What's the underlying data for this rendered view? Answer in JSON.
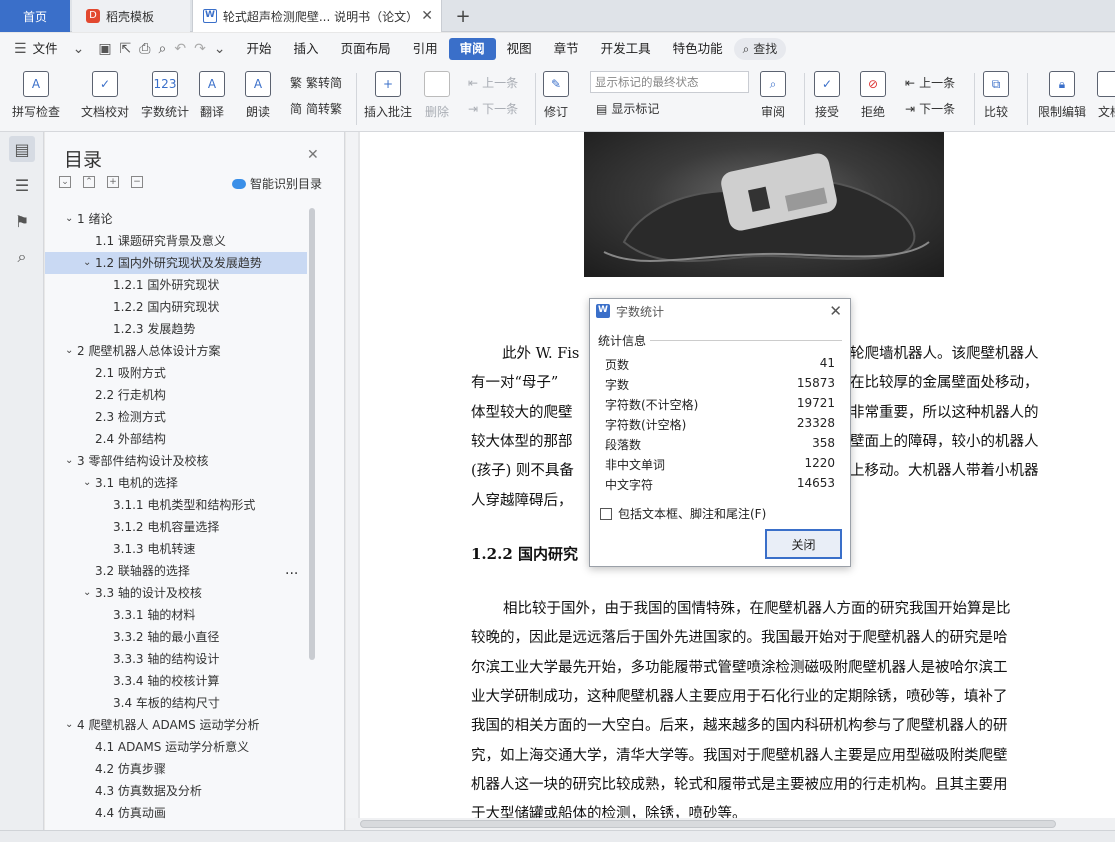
{
  "titlebar": {
    "home_tab": "首页",
    "template_tab": "稻壳模板",
    "doc_tab": "轮式超声检测爬壁... 说明书（论文）",
    "close_glyph": "✕",
    "add_glyph": "+"
  },
  "menubar": {
    "file": "文件",
    "items": [
      "开始",
      "插入",
      "页面布局",
      "引用",
      "审阅",
      "视图",
      "章节",
      "开发工具",
      "特色功能"
    ],
    "active": "审阅",
    "search": "查找"
  },
  "ribbon": {
    "spellcheck": "拼写检查",
    "proofread": "文档校对",
    "wordcount": "字数统计",
    "translate": "翻译",
    "read_aloud": "朗读",
    "trad_to_simp": "繁转简",
    "simp_to_trad": "简转繁",
    "insert_comment": "插入批注",
    "delete": "删除",
    "prev_item": "上一条",
    "next_item": "下一条",
    "track_changes": "修订",
    "markup_state": "显示标记的最终状态",
    "show_markup": "显示标记",
    "review": "审阅",
    "accept": "接受",
    "reject": "拒绝",
    "prev": "上一条",
    "next": "下一条",
    "compare": "比较",
    "restrict": "限制编辑",
    "doc_right": "文档"
  },
  "toc": {
    "title": "目录",
    "smart": "智能识别目录",
    "items": [
      {
        "text": "1  绪论",
        "level": 1,
        "exp": true
      },
      {
        "text": "1.1 课题研究背景及意义",
        "level": 2
      },
      {
        "text": "1.2 国内外研究现状及发展趋势",
        "level": 2,
        "exp": true,
        "sel": true
      },
      {
        "text": "1.2.1 国外研究现状",
        "level": 3
      },
      {
        "text": "1.2.2 国内研究现状",
        "level": 3
      },
      {
        "text": "1.2.3 发展趋势",
        "level": 3
      },
      {
        "text": "2 爬壁机器人总体设计方案",
        "level": 1,
        "exp": true
      },
      {
        "text": "2.1 吸附方式",
        "level": 2
      },
      {
        "text": "2.2 行走机构",
        "level": 2
      },
      {
        "text": "2.3 检测方式",
        "level": 2
      },
      {
        "text": "2.4 外部结构",
        "level": 2
      },
      {
        "text": "3 零部件结构设计及校核",
        "level": 1,
        "exp": true
      },
      {
        "text": "3.1 电机的选择",
        "level": 2,
        "exp": true
      },
      {
        "text": "3.1.1 电机类型和结构形式",
        "level": 3
      },
      {
        "text": "3.1.2 电机容量选择",
        "level": 3
      },
      {
        "text": "3.1.3 电机转速",
        "level": 3
      },
      {
        "text": "3.2 联轴器的选择",
        "level": 2
      },
      {
        "text": "3.3 轴的设计及校核",
        "level": 2,
        "exp": true
      },
      {
        "text": "3.3.1 轴的材料",
        "level": 3
      },
      {
        "text": "3.3.2 轴的最小直径",
        "level": 3
      },
      {
        "text": "3.3.3 轴的结构设计",
        "level": 3
      },
      {
        "text": "3.3.4 轴的校核计算",
        "level": 3
      },
      {
        "text": "3.4 车板的结构尺寸",
        "level": 3
      },
      {
        "text": "4  爬壁机器人 ADAMS 运动学分析",
        "level": 1,
        "exp": true
      },
      {
        "text": "4.1 ADAMS 运动学分析意义",
        "level": 2
      },
      {
        "text": "4.2 仿真步骤",
        "level": 2
      },
      {
        "text": "4.3 仿真数据及分析",
        "level": 2
      },
      {
        "text": "4.4 仿真动画",
        "level": 2
      }
    ],
    "more": "..."
  },
  "document": {
    "para1": [
      "此外 W. Fis",
      "有一对“母子”",
      "体型较大的爬壁",
      "较大体型的那部",
      "(孩子) 则不具备",
      "人穿越障碍后，"
    ],
    "para1_right": [
      "轮爬墙机器人。该爬壁机器人",
      "在比较厚的金属壁面处移动，",
      "非常重要，所以这种机器人的",
      "壁面上的障碍，较小的机器人",
      "上移动。大机器人带着小机器",
      ""
    ],
    "heading": "1.2.2 国内研究",
    "para2": [
      "相比较于国外，由于我国的国情特殊，在爬壁机器人方面的研究我国开始算是比",
      "较晚的，因此是远远落后于国外先进国家的。我国最开始对于爬壁机器人的研究是哈",
      "尔滨工业大学最先开始，多功能履带式管壁喷涂检测磁吸附爬壁机器人是被哈尔滨工",
      "业大学研制成功，这种爬壁机器人主要应用于石化行业的定期除锈，喷砂等，填补了",
      "我国的相关方面的一大空白。后来，越来越多的国内科研机构参与了爬壁机器人的研",
      "究，如上海交通大学，清华大学等。我国对于爬壁机器人主要是应用型磁吸附类爬壁",
      "机器人这一块的研究比较成熟，轮式和履带式是主要被应用的行走机构。且其主要用",
      "于大型储罐或船体的检测，除锈，喷砂等。"
    ]
  },
  "dialog": {
    "title": "字数统计",
    "section": "统计信息",
    "stats": [
      {
        "label": "页数",
        "value": "41"
      },
      {
        "label": "字数",
        "value": "15873"
      },
      {
        "label": "字符数(不计空格)",
        "value": "19721"
      },
      {
        "label": "字符数(计空格)",
        "value": "23328"
      },
      {
        "label": "段落数",
        "value": "358"
      },
      {
        "label": "非中文单词",
        "value": "1220"
      },
      {
        "label": "中文字符",
        "value": "14653"
      }
    ],
    "checkbox_label": "包括文本框、脚注和尾注(F)",
    "close_button": "关闭"
  }
}
